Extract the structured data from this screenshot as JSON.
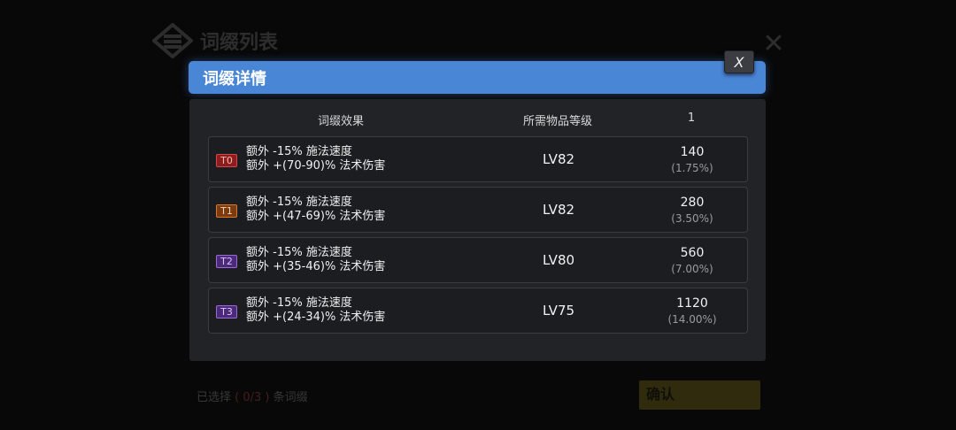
{
  "background": {
    "title": "词缀列表",
    "close_symbol": "✕",
    "selected_prefix": "已选择",
    "selected_count": "( 0/3 )",
    "selected_suffix": "条词缀",
    "confirm_label": "确认"
  },
  "modal": {
    "title": "词缀详情",
    "close_label": "X",
    "headers": {
      "effect": "词缀效果",
      "level": "所需物品等级",
      "weight": "1"
    },
    "rows": [
      {
        "tier": "T0",
        "line1": "额外 -15% 施法速度",
        "line2": "额外 +(70-90)% 法术伤害",
        "level": "LV82",
        "weight": "140",
        "percent": "(1.75%)"
      },
      {
        "tier": "T1",
        "line1": "额外 -15% 施法速度",
        "line2": "额外 +(47-69)% 法术伤害",
        "level": "LV82",
        "weight": "280",
        "percent": "(3.50%)"
      },
      {
        "tier": "T2",
        "line1": "额外 -15% 施法速度",
        "line2": "额外 +(35-46)% 法术伤害",
        "level": "LV80",
        "weight": "560",
        "percent": "(7.00%)"
      },
      {
        "tier": "T3",
        "line1": "额外 -15% 施法速度",
        "line2": "额外 +(24-34)% 法术伤害",
        "level": "LV75",
        "weight": "1120",
        "percent": "(14.00%)"
      }
    ]
  },
  "colors": {
    "header_blue": "#4a86d6",
    "tier_t0": "#8a1d1d",
    "tier_t1": "#7a3a12",
    "tier_t2": "#4b2a7a",
    "tier_t3": "#4b2a7a"
  },
  "icons": {
    "background_logo": "affix-list-emblem-icon",
    "background_close": "close-icon"
  }
}
